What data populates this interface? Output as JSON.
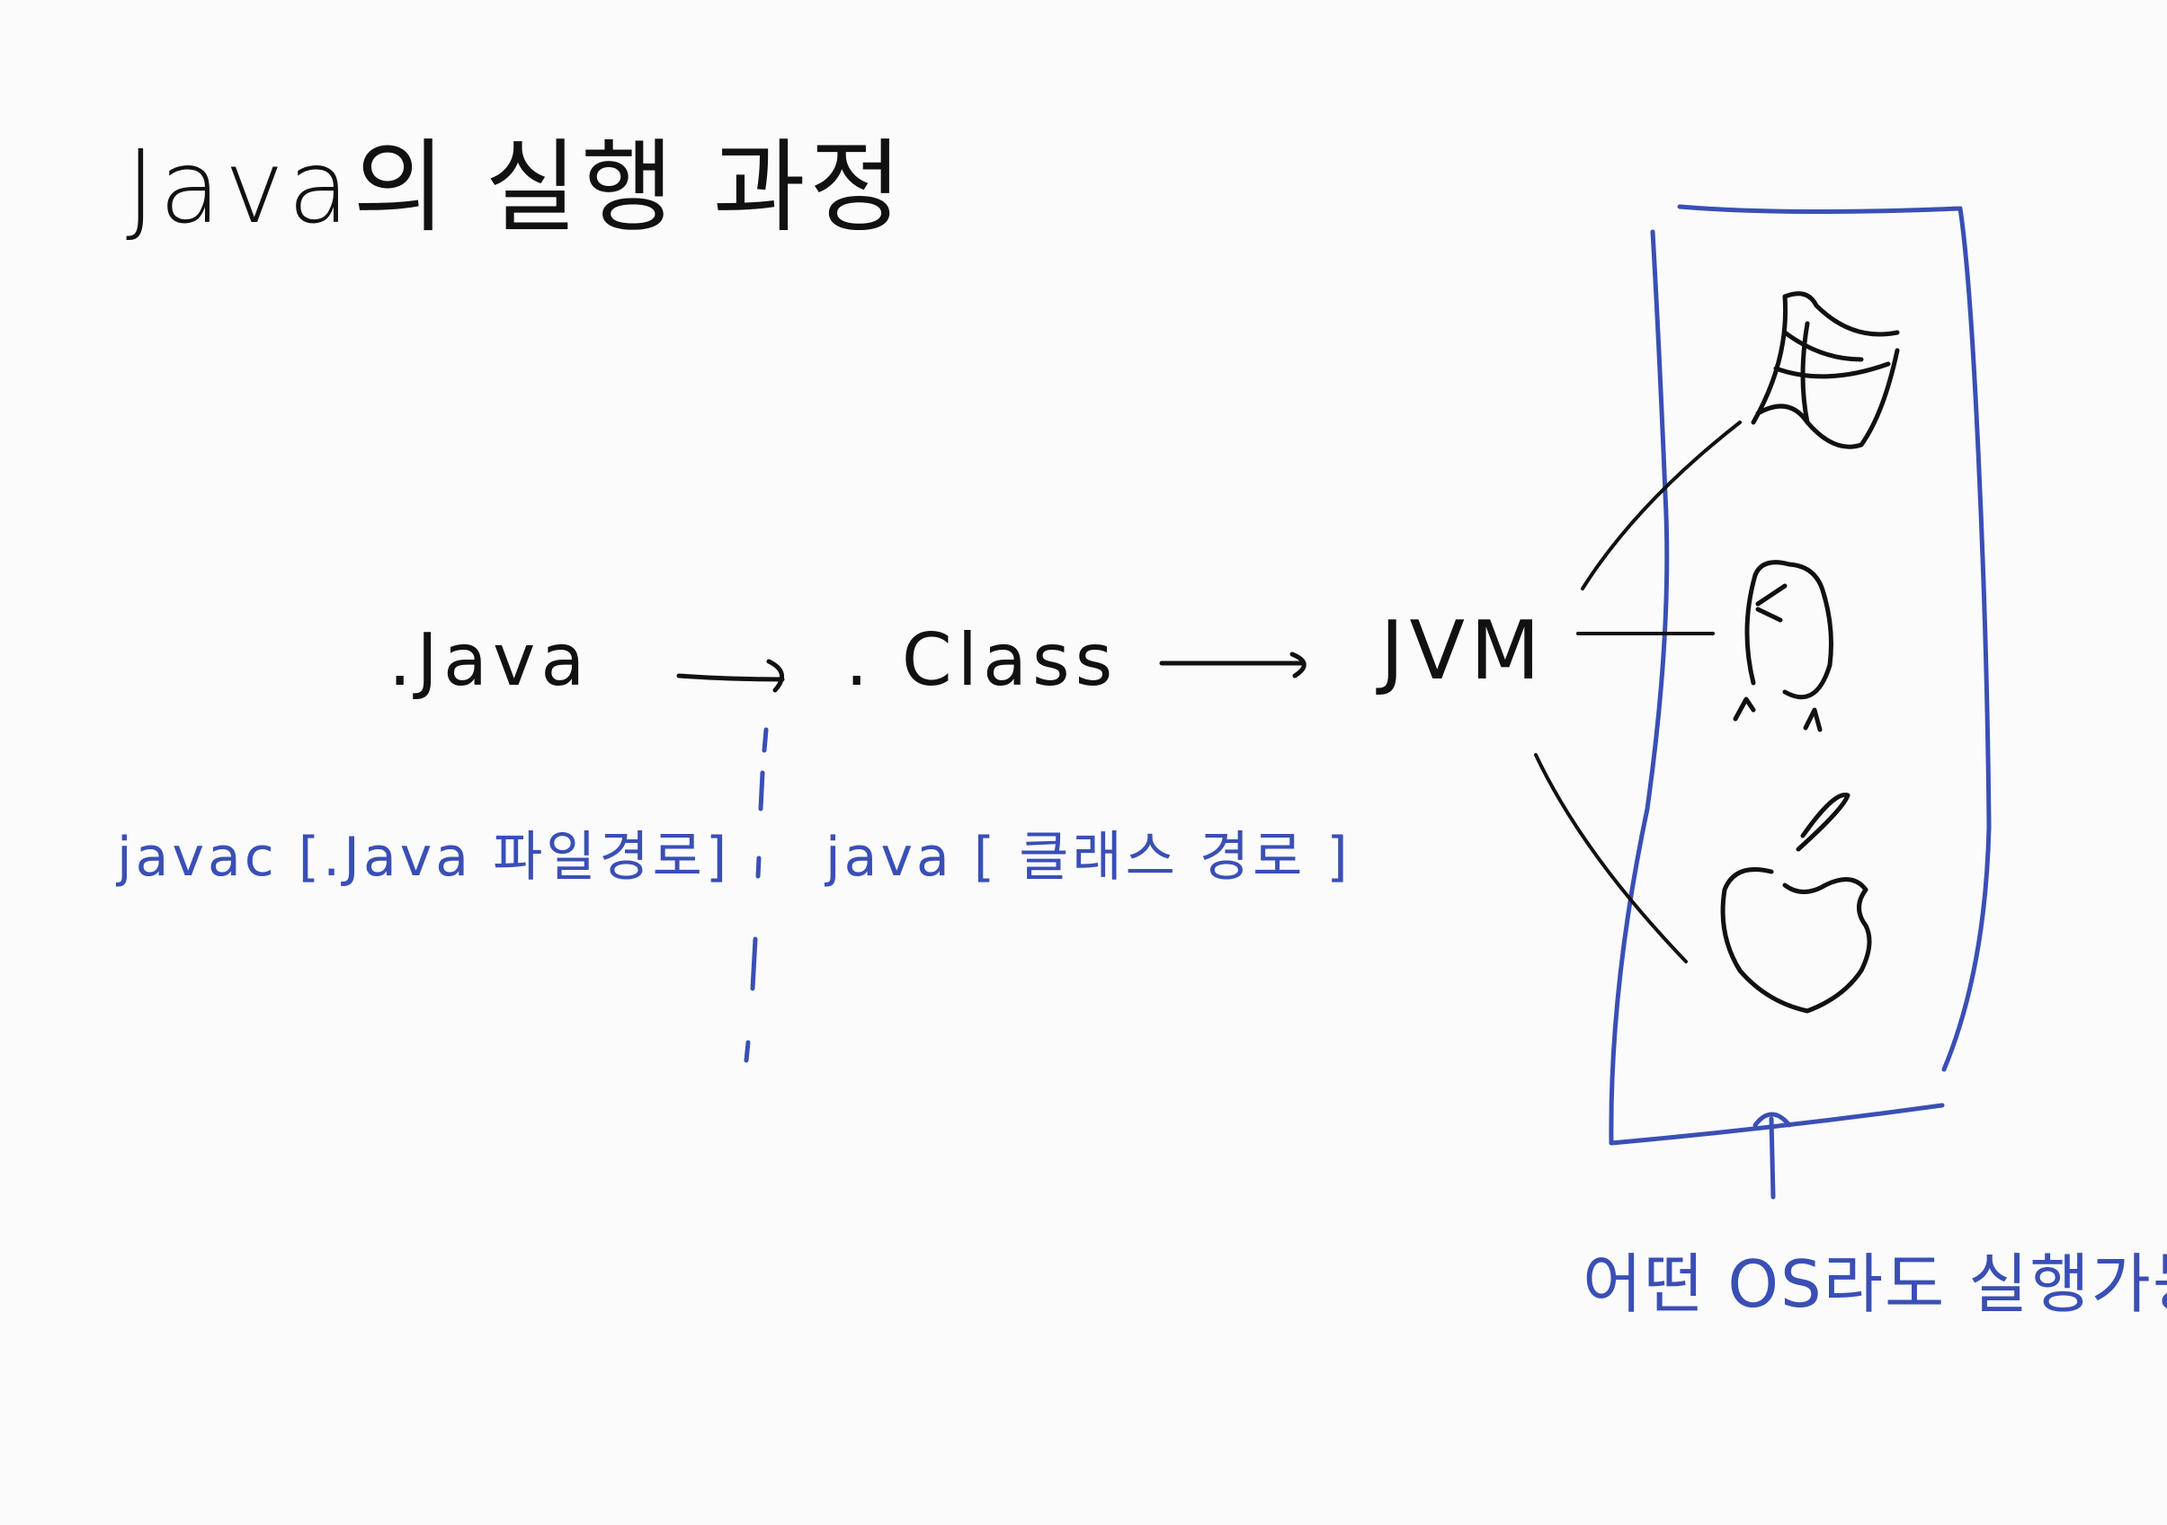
{
  "title": "Java의 실행 과정",
  "nodes": {
    "source": ".Java",
    "bytecode": ". Class",
    "vm": "JVM"
  },
  "commands": {
    "compile": "javac [.Java 파일경로]",
    "run": "java [ 클래스 경로 ]"
  },
  "os_note": "어떤 OS라도 실행가능!",
  "os_icons": [
    "windows-logo",
    "linux-penguin",
    "apple-logo"
  ],
  "colors": {
    "ink_black": "#111111",
    "ink_blue": "#3a4fb5",
    "background": "#fbfbfb"
  }
}
